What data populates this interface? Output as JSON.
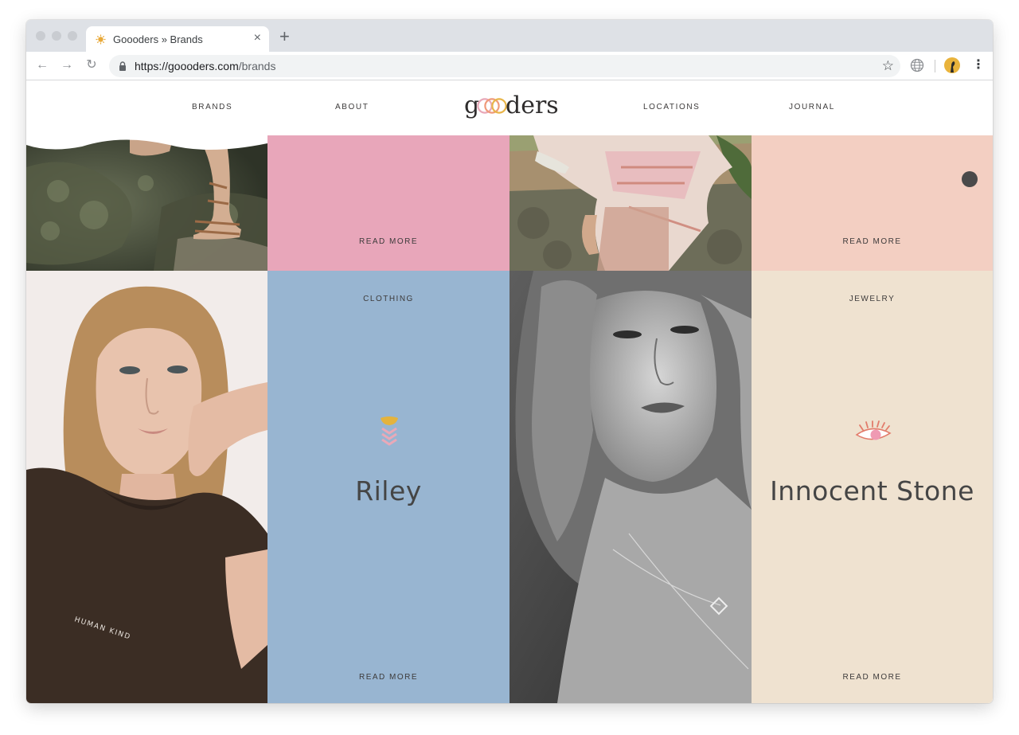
{
  "browser": {
    "tab_title": "Goooders » Brands",
    "close_glyph": "×",
    "newtab_glyph": "+",
    "back_glyph": "←",
    "forward_glyph": "→",
    "reload_glyph": "↻",
    "url_host": "https://goooders.com",
    "url_path": "/brands",
    "star_glyph": "☆",
    "menu_glyph": "⋮"
  },
  "site": {
    "logo_text": "goooders",
    "nav": {
      "brands": "BRANDS",
      "about": "ABOUT",
      "locations": "LOCATIONS",
      "journal": "JOURNAL"
    },
    "cards_top": {
      "pink_read_more": "READ MORE",
      "peach_read_more": "READ MORE"
    },
    "cards": [
      {
        "category": "CLOTHING",
        "name": "Riley",
        "read_more": "READ MORE",
        "icon": "flower-icon",
        "background": "#98b5d1"
      },
      {
        "category": "JEWELRY",
        "name": "Innocent Stone",
        "read_more": "READ MORE",
        "icon": "eye-icon",
        "background": "#efe2d0"
      }
    ],
    "colors": {
      "pink": "#e8a6ba",
      "peach": "#f3cfc2",
      "blue": "#98b5d1",
      "cream": "#efe2d0"
    }
  }
}
